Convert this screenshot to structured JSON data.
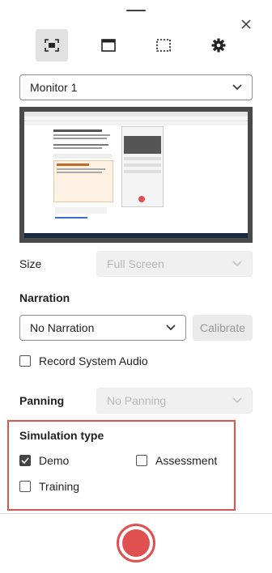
{
  "icons": {
    "drag_handle": "drag-handle",
    "close": "close-icon",
    "modes": [
      "fullscreen-capture-icon",
      "window-capture-icon",
      "region-capture-icon",
      "settings-gear-icon"
    ]
  },
  "monitor": {
    "selected": "Monitor 1"
  },
  "size": {
    "label": "Size",
    "value": "Full Screen"
  },
  "narration": {
    "label": "Narration",
    "value": "No Narration",
    "calibrate": "Calibrate",
    "record_system_audio": "Record System Audio",
    "record_system_audio_checked": false
  },
  "panning": {
    "label": "Panning",
    "value": "No Panning"
  },
  "simulation": {
    "title": "Simulation type",
    "options": [
      {
        "label": "Demo",
        "checked": true
      },
      {
        "label": "Assessment",
        "checked": false
      },
      {
        "label": "Training",
        "checked": false
      }
    ]
  },
  "colors": {
    "accent_red": "#e05050",
    "highlight_border": "#e2514e",
    "active_mode_bg": "#e2e2e2"
  }
}
